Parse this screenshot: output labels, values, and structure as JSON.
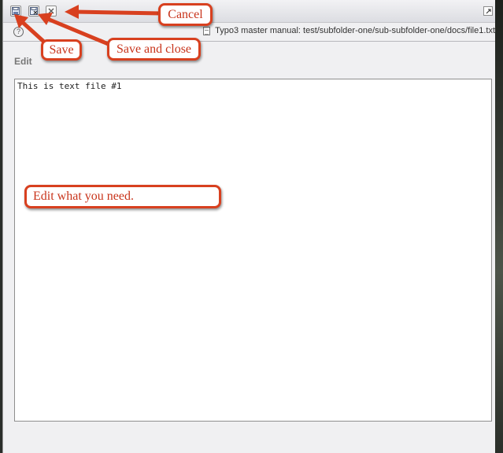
{
  "toolbar": {
    "buttons": [
      {
        "name": "save-icon",
        "tooltip": "Save"
      },
      {
        "name": "save-and-close-icon",
        "tooltip": "Save and close"
      },
      {
        "name": "close-icon",
        "tooltip": "Cancel"
      }
    ]
  },
  "infobar": {
    "help_glyph": "?",
    "path": "Typo3 master manual: test/subfolder-one/sub-subfolder-one/docs/file1.txt"
  },
  "section": {
    "heading": "Edit"
  },
  "editor": {
    "content": "This is text file #1"
  },
  "annotations": {
    "cancel": "Cancel",
    "save": "Save",
    "save_and_close": "Save and close",
    "edit_hint": "Edit what you need."
  },
  "colors": {
    "annotation_border": "#d8401f",
    "annotation_text": "#c8341b"
  }
}
